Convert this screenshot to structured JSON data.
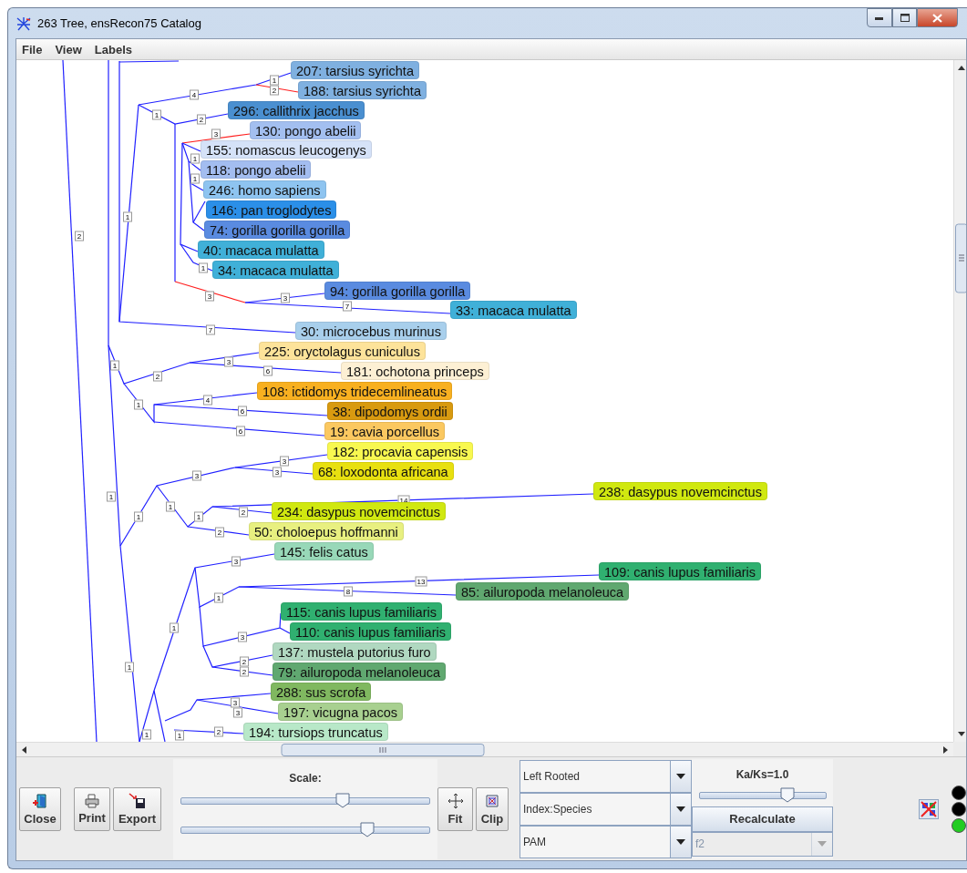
{
  "window": {
    "title": "263 Tree, ensRecon75 Catalog"
  },
  "menu": [
    "File",
    "View",
    "Labels"
  ],
  "tree": {
    "leaves": [
      {
        "label": "207: tarsius syrichta",
        "color": "#7fb0e0"
      },
      {
        "label": "188: tarsius syrichta",
        "color": "#7fb0e0"
      },
      {
        "label": "296: callithrix jacchus",
        "color": "#4a8fd0"
      },
      {
        "label": "130: pongo abelii",
        "color": "#a3bff0"
      },
      {
        "label": "155: nomascus leucogenys",
        "color": "#d5e2f8"
      },
      {
        "label": "118: pongo abelii",
        "color": "#a3bdf0"
      },
      {
        "label": "246: homo sapiens",
        "color": "#8ec4f0"
      },
      {
        "label": "146: pan troglodytes",
        "color": "#2b8fe8"
      },
      {
        "label": "74: gorilla gorilla gorilla",
        "color": "#5a8be0"
      },
      {
        "label": "40: macaca mulatta",
        "color": "#40b0d8"
      },
      {
        "label": "34: macaca mulatta",
        "color": "#40b0d8"
      },
      {
        "label": "94: gorilla gorilla gorilla",
        "color": "#5a8be0"
      },
      {
        "label": "33: macaca mulatta",
        "color": "#40b0d8"
      },
      {
        "label": "30: microcebus murinus",
        "color": "#a8cfec"
      },
      {
        "label": "225: oryctolagus cuniculus",
        "color": "#fde39a"
      },
      {
        "label": "181: ochotona princeps",
        "color": "#fdf0d4"
      },
      {
        "label": "108: ictidomys tridecemlineatus",
        "color": "#f8b020"
      },
      {
        "label": "38: dipodomys ordii",
        "color": "#d89a10"
      },
      {
        "label": "19: cavia porcellus",
        "color": "#fbc860"
      },
      {
        "label": "182: procavia capensis",
        "color": "#f8f850"
      },
      {
        "label": "68: loxodonta africana",
        "color": "#e8e010"
      },
      {
        "label": "238: dasypus novemcinctus",
        "color": "#d0e810"
      },
      {
        "label": "234: dasypus novemcinctus",
        "color": "#d0e810"
      },
      {
        "label": "50: choloepus hoffmanni",
        "color": "#e8f080"
      },
      {
        "label": "145: felis catus",
        "color": "#98d8b8"
      },
      {
        "label": "109: canis lupus familiaris",
        "color": "#30b070"
      },
      {
        "label": "85: ailuropoda melanoleuca",
        "color": "#60a870"
      },
      {
        "label": "115: canis lupus familiaris",
        "color": "#30b070"
      },
      {
        "label": "110: canis lupus familiaris",
        "color": "#30b070"
      },
      {
        "label": "137: mustela putorius furo",
        "color": "#b0d8c0"
      },
      {
        "label": "79: ailuropoda melanoleuca",
        "color": "#60a870"
      },
      {
        "label": "288: sus scrofa",
        "color": "#80b860"
      },
      {
        "label": "197: vicugna pacos",
        "color": "#a8d090"
      },
      {
        "label": "194: tursiops truncatus",
        "color": "#b8e8c8"
      }
    ],
    "branch_labels": [
      "2",
      "1",
      "4",
      "1",
      "2",
      "1",
      "2",
      "3",
      "1",
      "1",
      "1",
      "3",
      "3",
      "7",
      "7",
      "1",
      "3",
      "2",
      "6",
      "1",
      "4",
      "6",
      "6",
      "3",
      "3",
      "3",
      "1",
      "1",
      "1",
      "1",
      "2",
      "14",
      "2",
      "3",
      "1",
      "8",
      "13",
      "1",
      "3",
      "2",
      "2",
      "1",
      "3",
      "3",
      "2",
      "1",
      "1"
    ]
  },
  "toolbar": {
    "buttons": [
      {
        "label": "Close"
      },
      {
        "label": "Print"
      },
      {
        "label": "Export"
      }
    ],
    "scale": {
      "title": "Scale:",
      "sliders": [
        {
          "level": 0.65
        },
        {
          "level": 0.75
        }
      ]
    },
    "view_buttons": [
      {
        "label": "Fit"
      },
      {
        "label": "Clip"
      }
    ],
    "dropdowns": [
      {
        "value": "Left Rooted"
      },
      {
        "value": "Index:Species"
      },
      {
        "value": "PAM"
      }
    ],
    "kaks": {
      "label": "Ka/Ks=1.0",
      "level": 0.7
    },
    "recalculate": "Recalculate",
    "matrix": {
      "value": "f2",
      "disabled": true
    },
    "lights": [
      {
        "color": "#000000"
      },
      {
        "color": "#000000"
      },
      {
        "color": "#22cc22"
      }
    ]
  }
}
